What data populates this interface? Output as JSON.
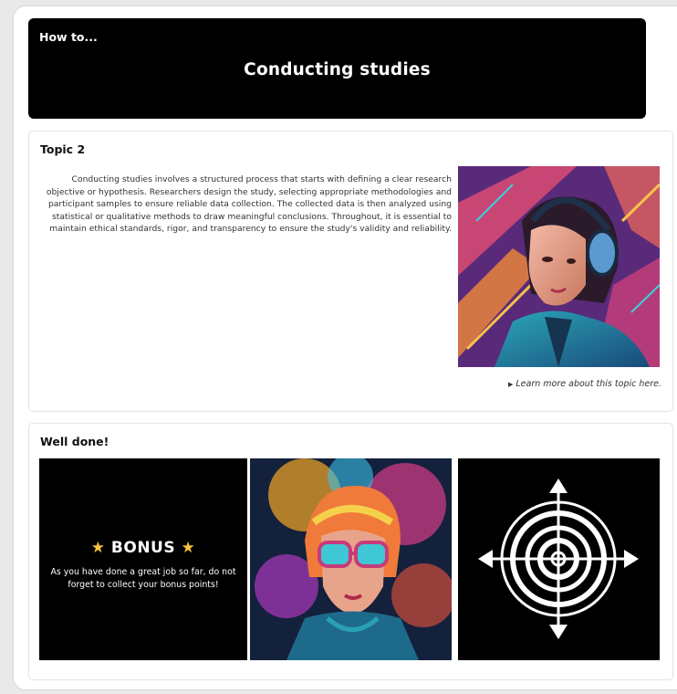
{
  "header": {
    "kicker": "How to...",
    "title": "Conducting studies"
  },
  "topic": {
    "title": "Topic 2",
    "body": "Conducting studies involves a structured process that starts with defining a clear research objective or hypothesis. Researchers design the study, selecting appropriate methodologies and participant samples to ensure reliable data collection. The collected data is then analyzed using statistical or qualitative methods to draw meaningful conclusions. Throughout, it is essential to maintain ethical standards, rigor, and transparency to ensure the study's validity and reliability.",
    "image_icon": "woman-headphones-illustration",
    "learn_more": "Learn more about this topic here."
  },
  "completion": {
    "title": "Well done!",
    "bonus": {
      "heading": "BONUS",
      "star_icon": "star-icon",
      "text": "As you have done a great job so far, do not forget to collect your bonus points!"
    },
    "image_icon": "woman-sunglasses-illustration",
    "target_icon": "target-arrows-icon"
  },
  "colors": {
    "header_bg": "#000000",
    "star": "#f5c542",
    "page_bg": "#ffffff"
  }
}
